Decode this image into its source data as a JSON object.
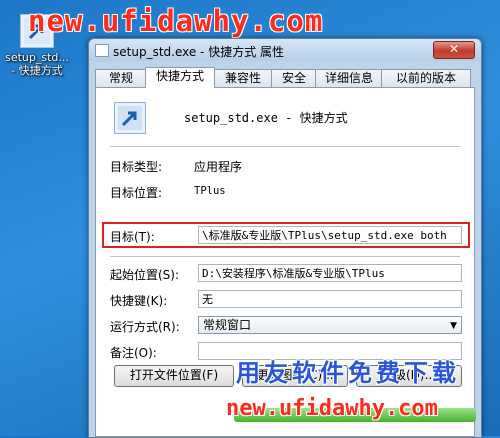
{
  "desktop_icon": {
    "label_line1": "setup_std...",
    "label_line2": "- 快捷方式"
  },
  "watermark": {
    "top_url": "new.ufidawhy.com",
    "slogan": "用友软件免费下载",
    "bottom_url": "new.ufidawhy.com"
  },
  "window": {
    "title": "setup_std.exe - 快捷方式 属性",
    "close_label": "✕"
  },
  "tabs": [
    {
      "label": "常规"
    },
    {
      "label": "快捷方式"
    },
    {
      "label": "兼容性"
    },
    {
      "label": "安全"
    },
    {
      "label": "详细信息"
    },
    {
      "label": "以前的版本"
    }
  ],
  "header": {
    "title": "setup_std.exe - 快捷方式"
  },
  "info": {
    "type_label": "目标类型:",
    "type_value": "应用程序",
    "location_label": "目标位置:",
    "location_value": "TPlus"
  },
  "fields": {
    "target_label": "目标(T):",
    "target_value": "\\标准版&专业版\\TPlus\\setup_std.exe both",
    "start_label": "起始位置(S):",
    "start_value": "D:\\安装程序\\标准版&专业版\\TPlus",
    "hotkey_label": "快捷键(K):",
    "hotkey_value": "无",
    "run_label": "运行方式(R):",
    "run_value": "常规窗口",
    "comment_label": "备注(O):",
    "comment_value": ""
  },
  "buttons": {
    "open_location": "打开文件位置(F)",
    "change_icon": "更改图标(C)...",
    "advanced": "高级(D)..."
  },
  "colors": {
    "highlight_border": "#e02020",
    "watermark_red": "#ff2a1a",
    "watermark_blue": "#2a55d8"
  }
}
